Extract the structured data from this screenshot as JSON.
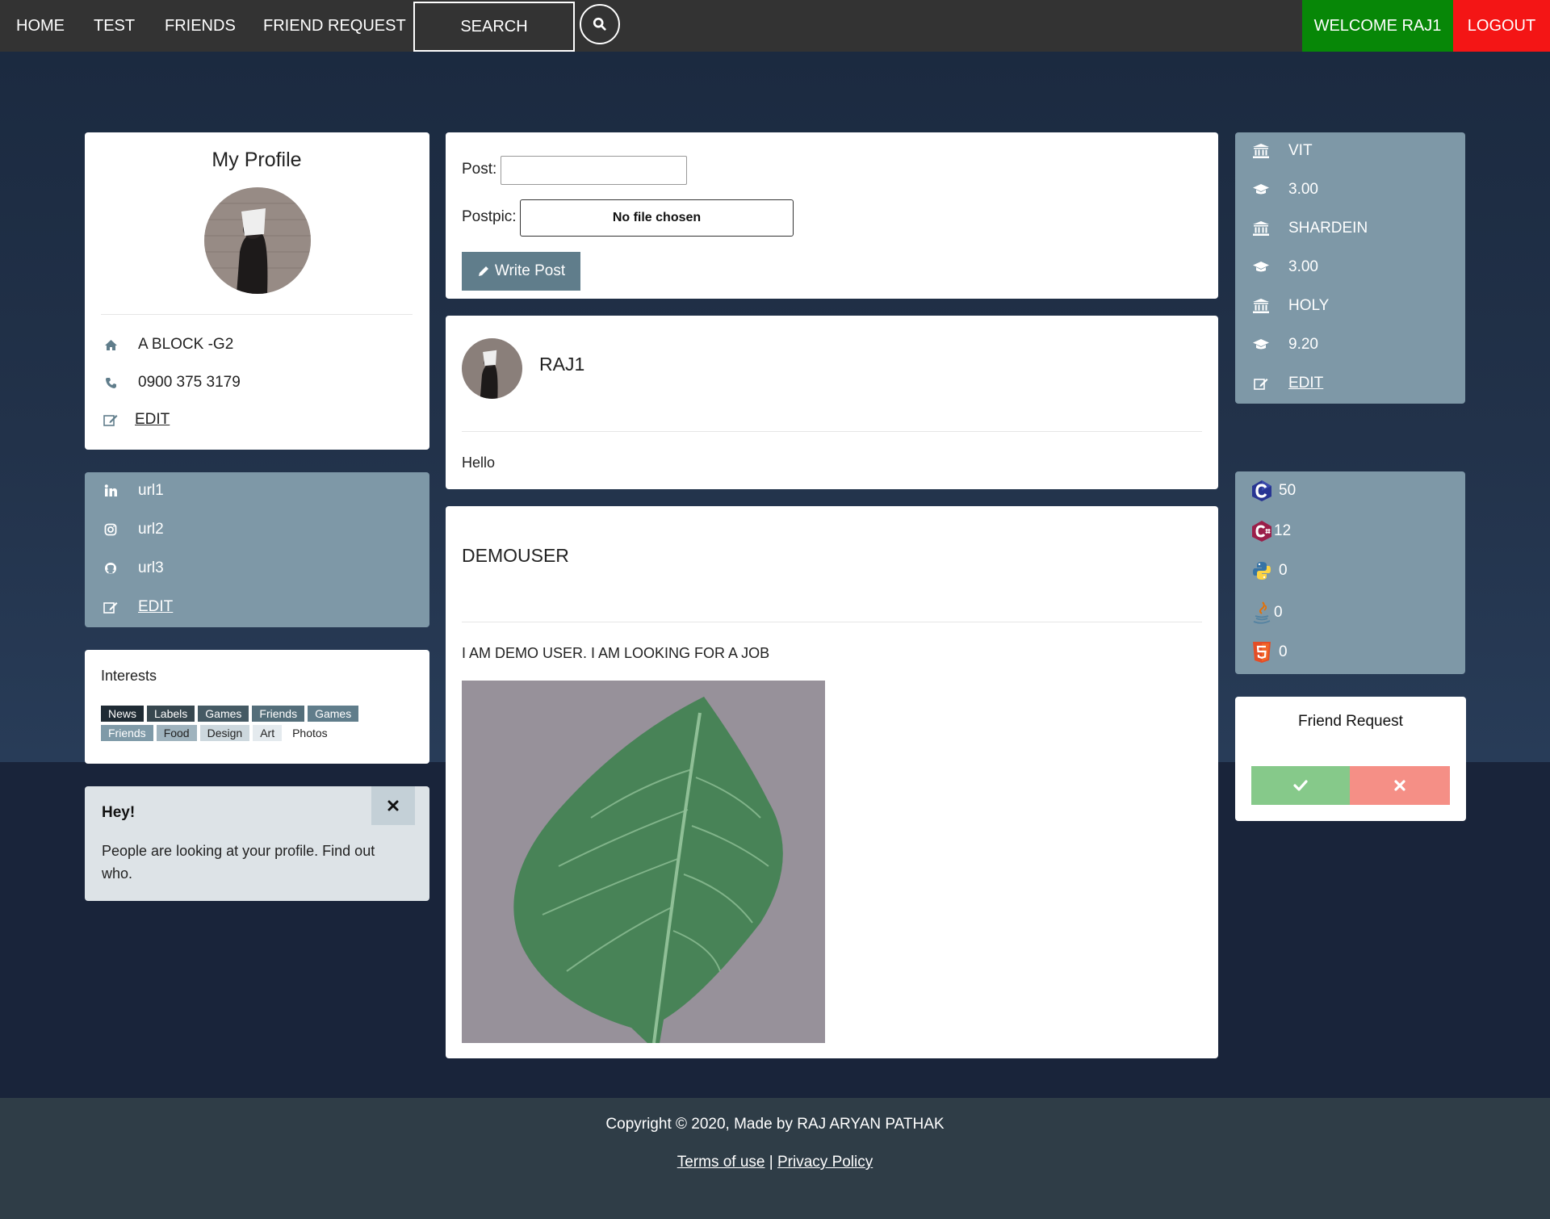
{
  "nav": {
    "home": "HOME",
    "test": "TEST",
    "friends": "FRIENDS",
    "friend_request": "FRIEND REQUEST",
    "search": "SEARCH",
    "welcome": "WELCOME RAJ1",
    "logout": "LOGOUT"
  },
  "profile": {
    "title": "My Profile",
    "address": "A BLOCK -G2",
    "phone": "0900 375 3179",
    "edit": "EDIT"
  },
  "social": {
    "linkedin": "url1",
    "instagram": "url2",
    "github": "url3",
    "edit": "EDIT"
  },
  "interests": {
    "title": "Interests",
    "tags": [
      "News",
      "Labels",
      "Games",
      "Friends",
      "Games",
      "Friends",
      "Food",
      "Design",
      "Art",
      "Photos"
    ]
  },
  "alert": {
    "title": "Hey!",
    "message": "People are looking at your profile. Find out who."
  },
  "composer": {
    "post_label": "Post:",
    "post_value": "",
    "postpic_label": "Postpic:",
    "file_text": "No file chosen",
    "write_button": "Write Post"
  },
  "posts": [
    {
      "author": "RAJ1",
      "text": "Hello"
    },
    {
      "author": "DEMOUSER",
      "text": "I AM DEMO USER. I AM LOOKING FOR A JOB"
    }
  ],
  "education": {
    "school1": "VIT",
    "grade1": "3.00",
    "school2": "SHARDEIN",
    "grade2": "3.00",
    "school3": "HOLY",
    "grade3": "9.20",
    "edit": "EDIT"
  },
  "skills": {
    "c": "50",
    "cpp": "12",
    "python": "0",
    "java": "0",
    "html5": "0"
  },
  "friend_request": {
    "title": "Friend Request"
  },
  "footer": {
    "copyright": "Copyright © 2020, Made by RAJ ARYAN PATHAK",
    "terms": "Terms of use",
    "separator": "|",
    "privacy": "Privacy Policy"
  },
  "colors": {
    "navbar": "#333333",
    "welcome": "#078707",
    "logout": "#f41515",
    "slate": "#7e98a7",
    "button": "#607d8b",
    "accept": "#86c98a",
    "reject": "#f58f86"
  }
}
